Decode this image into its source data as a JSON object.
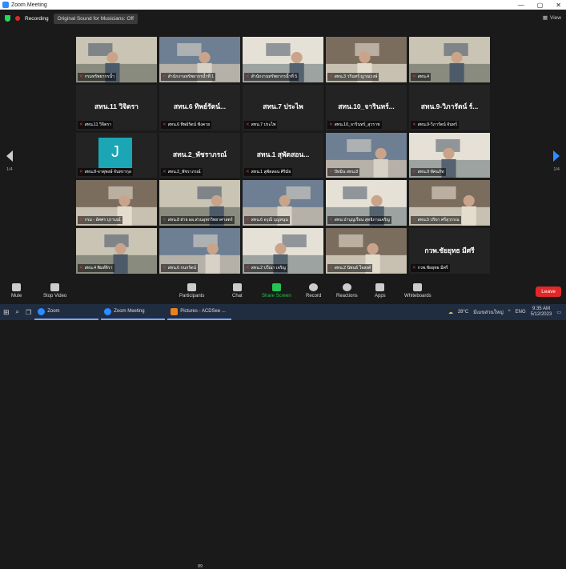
{
  "window": {
    "title": "Zoom Meeting"
  },
  "topbar": {
    "recording": "Recording",
    "original_sound": "Original Sound for Musicians: Off",
    "view": "View"
  },
  "pages": {
    "left": "1/4",
    "right": "1/4"
  },
  "tiles": [
    {
      "type": "video",
      "label": "กรมทรัพยากรน้ำ",
      "active": true
    },
    {
      "type": "video",
      "label": "สำนักงานทรัพยากรน้ำที่ 1"
    },
    {
      "type": "video",
      "label": "สำนักงานทรัพยากรน้ำที่ 5"
    },
    {
      "type": "video",
      "label": "สทน.3 วรินทร์ ญาณวงษ์"
    },
    {
      "type": "video",
      "label": "สทน.4"
    },
    {
      "type": "text",
      "big": "สทน.11 วิจิตรา",
      "label": "สทน.11 วิจิตรา"
    },
    {
      "type": "text",
      "big": "สทน.6 ทิพย์รัตน์...",
      "label": "สทน.6 ทิพย์รัตน์ ฟังคาย"
    },
    {
      "type": "text",
      "big": "สทน.7 ประไพ",
      "label": "สทน.7 ประไพ"
    },
    {
      "type": "text",
      "big": "สทน.10_จารินทร์...",
      "label": "สทน.10_จารินทร์_สุวราช"
    },
    {
      "type": "text",
      "big": "สทน.9-วิภารัตน์ ร์...",
      "label": "สทน.9-วิภารัตน์ จันทร์"
    },
    {
      "type": "avatar",
      "avatar": "J",
      "label": "สทน.8-จาตุพงษ์ จันทรากุล"
    },
    {
      "type": "text",
      "big": "สทน.2_พัชราภรณ์",
      "label": "สทน.2_พัชราภรณ์"
    },
    {
      "type": "text",
      "big": "สทน.1 สุพัตสอน...",
      "label": "สทน.1 สุพัตสอน ศิริมัย"
    },
    {
      "type": "video",
      "label": "ปัทมิน สทน.8"
    },
    {
      "type": "video",
      "label": "สทน.9 ทัศนภัท"
    },
    {
      "type": "video",
      "label": "กรม - อัศศร บุรามณ์"
    },
    {
      "type": "video",
      "label": "สทน.8 ฝ่าย ผอ.ส่วนอุทกวิทยาศาสตร์"
    },
    {
      "type": "video",
      "label": "สทน.6 อรุณี บุญหนุน"
    },
    {
      "type": "video",
      "label": "สทน.ป่าบุญเรือน สุทธิภาณจริญ"
    },
    {
      "type": "video",
      "label": "สทน.5 ปริยา ศรีสุวรรณ"
    },
    {
      "type": "video",
      "label": "สทน.4 พิมพ์จิรา"
    },
    {
      "type": "video",
      "label": "สทน.6 กนกรัตน์"
    },
    {
      "type": "video",
      "label": "สทน.2 ปวีณา เจริญ"
    },
    {
      "type": "video",
      "label": "สทน.2 นิพนธ์ ใจสงค์"
    },
    {
      "type": "text",
      "big": "กวพ.ชัยยุทธ มีศรี",
      "label": "กวพ.ชัยยุทธ มีศรี"
    }
  ],
  "toolbar": {
    "mute": "Mute",
    "stop_video": "Stop Video",
    "participants": "Participants",
    "participants_count": "89",
    "chat": "Chat",
    "share_screen": "Share Screen",
    "record": "Record",
    "reactions": "Reactions",
    "apps": "Apps",
    "whiteboards": "Whiteboards",
    "leave": "Leave"
  },
  "taskbar": {
    "search_icon": "search-icon",
    "apps": [
      "Zoom",
      "Zoom Meeting",
      "Pictures - ACDSee ..."
    ],
    "weather": "28°C",
    "weather_text": "มีเมฆส่วนใหญ่",
    "lang": "ENG",
    "time": "9:35 AM",
    "date": "5/12/2023"
  },
  "colors": {
    "accent": "#2d8cff",
    "active_speaker": "#9cd44a",
    "leave": "#e02828",
    "share": "#23c552"
  }
}
